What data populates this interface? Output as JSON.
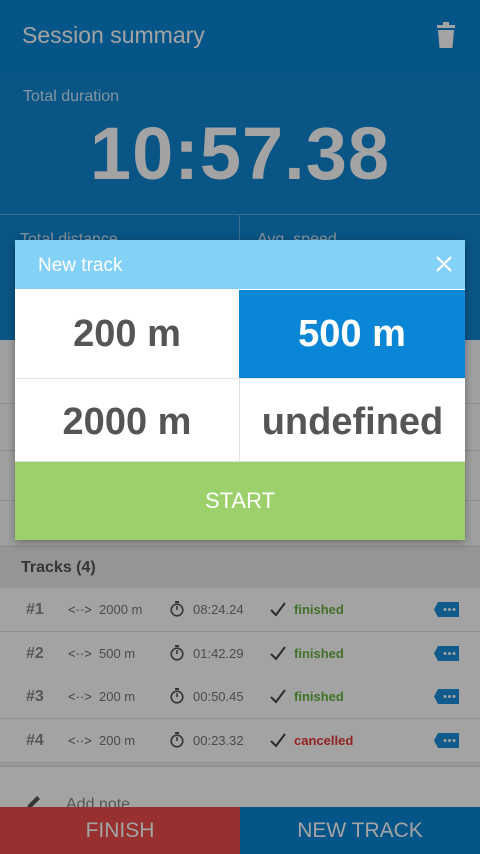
{
  "appbar": {
    "title": "Session summary",
    "trash_icon": "trash-icon"
  },
  "summary": {
    "total_duration_label": "Total duration",
    "total_duration": "10:57.38",
    "total_distance_label": "Total distance",
    "avg_speed_label": "Avg. speed"
  },
  "dialog": {
    "title": "New track",
    "close_icon": "close-icon",
    "options": [
      "200 m",
      "500 m",
      "2000 m",
      "undefined"
    ],
    "selected_option": "500 m",
    "start_label": "START"
  },
  "tracks": {
    "header": "Tracks (4)",
    "items": [
      {
        "num": "#1",
        "distance": "2000 m",
        "time": "08:24.24",
        "status": "finished"
      },
      {
        "num": "#2",
        "distance": "500 m",
        "time": "01:42.29",
        "status": "finished"
      },
      {
        "num": "#3",
        "distance": "200 m",
        "time": "00:50.45",
        "status": "finished"
      },
      {
        "num": "#4",
        "distance": "200 m",
        "time": "00:23.32",
        "status": "cancelled"
      }
    ]
  },
  "note": {
    "label": "Add note",
    "icon": "pencil-icon"
  },
  "actions": {
    "finish_label": "FINISH",
    "new_track_label": "NEW TRACK"
  },
  "colors": {
    "primary": "#0a86d6",
    "finish": "#f04c4c",
    "start": "#9bd06a",
    "dialog_header": "#84d1f7",
    "status_ok": "#67b33e",
    "status_bad": "#e53935"
  }
}
